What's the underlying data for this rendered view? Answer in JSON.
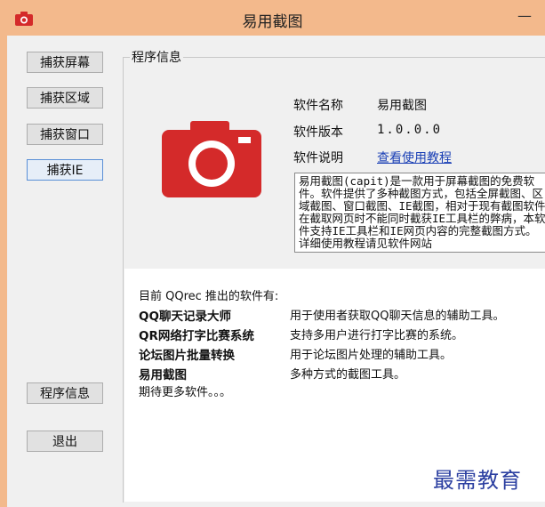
{
  "window": {
    "title": "易用截图",
    "minimize": "—"
  },
  "sidebar": {
    "buttons": [
      {
        "label": "捕获屏幕"
      },
      {
        "label": "捕获区域"
      },
      {
        "label": "捕获窗口"
      },
      {
        "label": "捕获IE"
      },
      {
        "label": "程序信息"
      },
      {
        "label": "退出"
      }
    ]
  },
  "group": {
    "title": "程序信息"
  },
  "info": {
    "name_label": "软件名称",
    "name_value": "易用截图",
    "version_label": "软件版本",
    "version_value": "1.0.0.0",
    "desc_label": "软件说明",
    "desc_link": "查看使用教程",
    "description": "易用截图(capit)是一款用于屏幕截图的免费软件。软件提供了多种截图方式，包括全屏截图、区域截图、窗口截图、IE截图，相对于现有截图软件在截取网页时不能同时截获IE工具栏的弊病，本软件支持IE工具栏和IE网页内容的完整截图方式。详细使用教程请见软件网站"
  },
  "products": {
    "intro": "目前 QQrec 推出的软件有:",
    "items": [
      {
        "name": "QQ聊天记录大师",
        "desc": "用于使用者获取QQ聊天信息的辅助工具。"
      },
      {
        "name": "QR网络打字比赛系统",
        "desc": "支持多用户进行打字比赛的系统。"
      },
      {
        "name": "论坛图片批量转换",
        "desc": "用于论坛图片处理的辅助工具。"
      },
      {
        "name": "易用截图",
        "desc": "多种方式的截图工具。"
      }
    ],
    "more": "期待更多软件。。。"
  },
  "watermark": "最需教育",
  "colors": {
    "titlebar": "#f3b98c",
    "camera_red": "#d42a2a",
    "link": "#1a3fb5"
  }
}
